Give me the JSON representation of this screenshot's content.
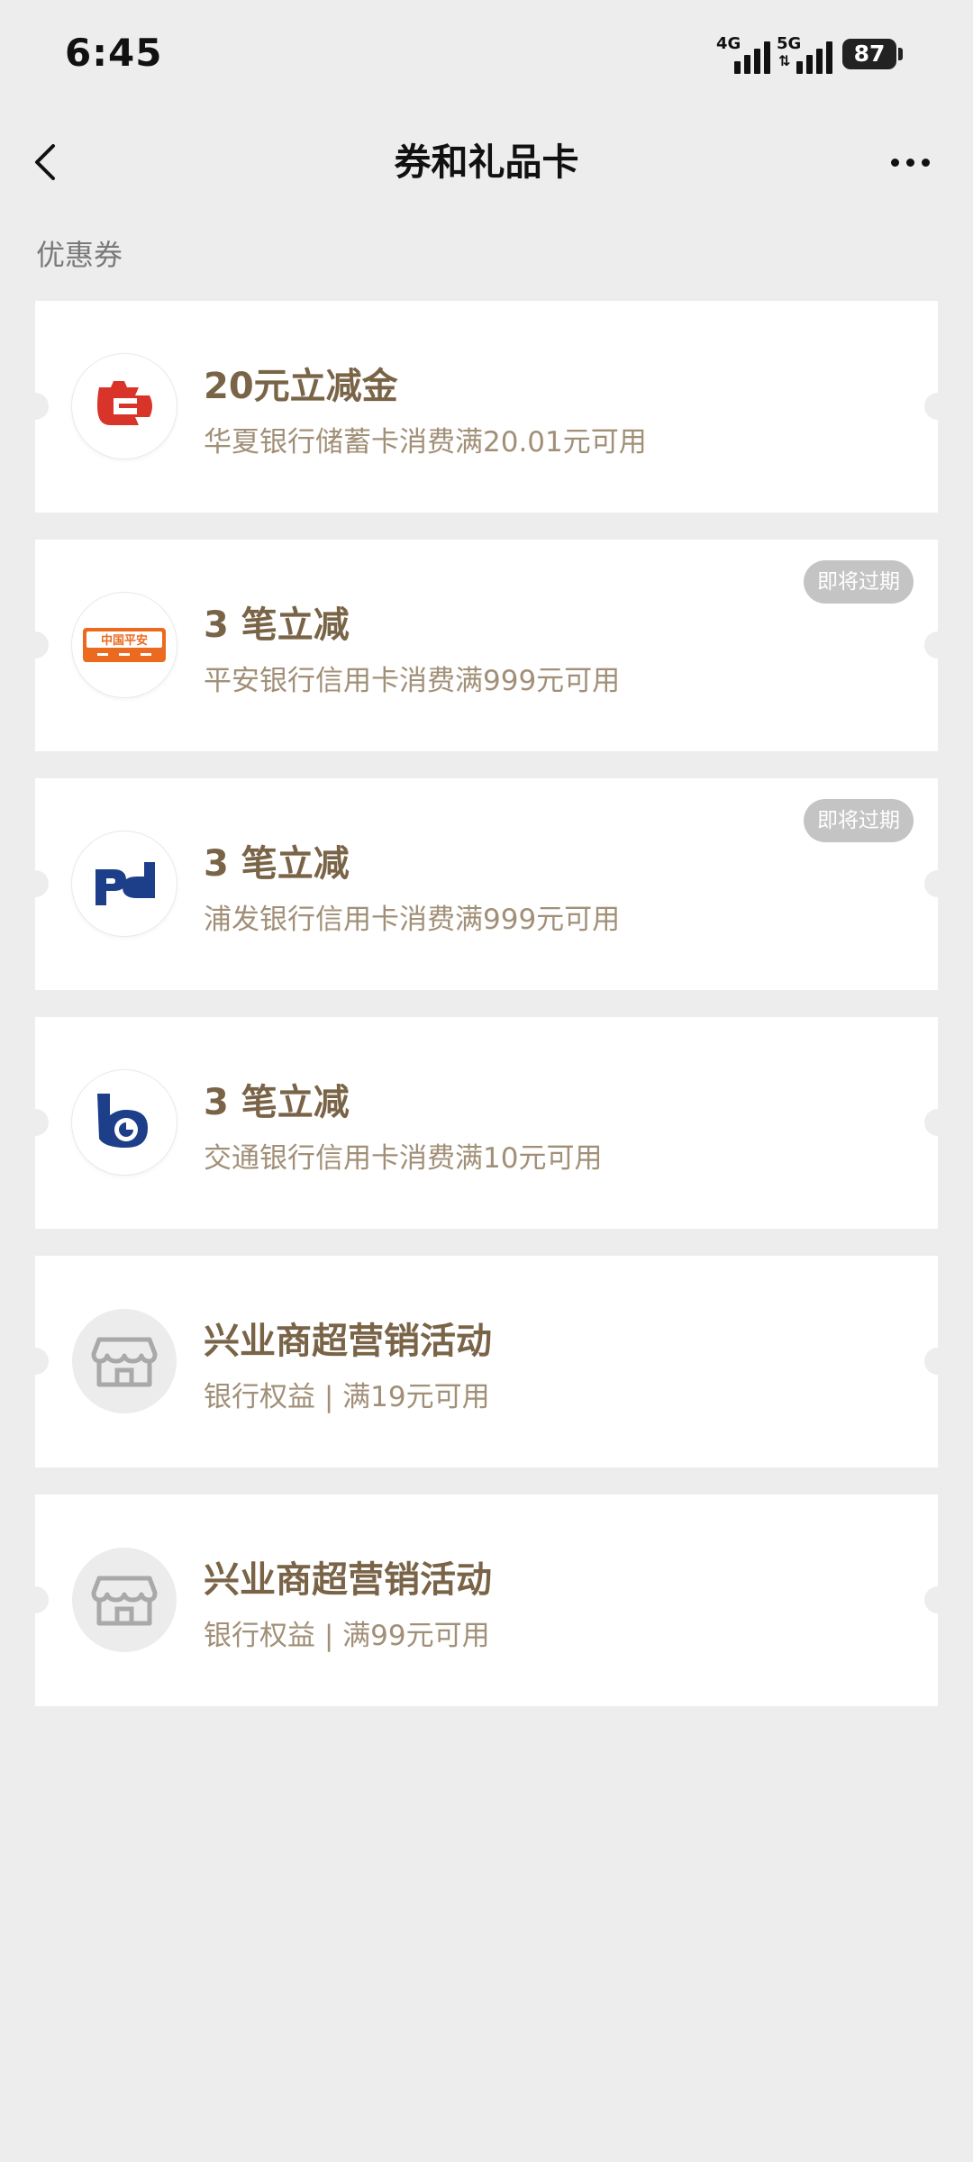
{
  "status_bar": {
    "time": "6:45",
    "signal_1": "4G",
    "signal_2": "5G",
    "battery": "87"
  },
  "nav": {
    "title": "券和礼品卡",
    "back_icon": "chevron-left-icon",
    "more_icon": "more-horizontal-icon"
  },
  "section_label": "优惠券",
  "colors": {
    "background": "#ededed",
    "card": "#ffffff",
    "title_gold": "#7a6448",
    "desc_gold": "#a18f77",
    "badge_gray": "#c4c4c4"
  },
  "coupons": [
    {
      "logo": "hua-xia-bank-logo",
      "title": "20元立减金",
      "desc": "华夏银行储蓄卡消费满20.01元可用",
      "badge": ""
    },
    {
      "logo": "ping-an-bank-logo",
      "logo_text": "中国平安",
      "title": "3 笔立减",
      "desc": "平安银行信用卡消费满999元可用",
      "badge": "即将过期"
    },
    {
      "logo": "spd-bank-logo",
      "title": "3 笔立减",
      "desc": "浦发银行信用卡消费满999元可用",
      "badge": "即将过期"
    },
    {
      "logo": "bocom-bank-logo",
      "title": "3 笔立减",
      "desc": "交通银行信用卡消费满10元可用",
      "badge": ""
    },
    {
      "logo": "store-icon",
      "title": "兴业商超营销活动",
      "desc": "银行权益 | 满19元可用",
      "badge": ""
    },
    {
      "logo": "store-icon",
      "title": "兴业商超营销活动",
      "desc": "银行权益 | 满99元可用",
      "badge": ""
    }
  ]
}
